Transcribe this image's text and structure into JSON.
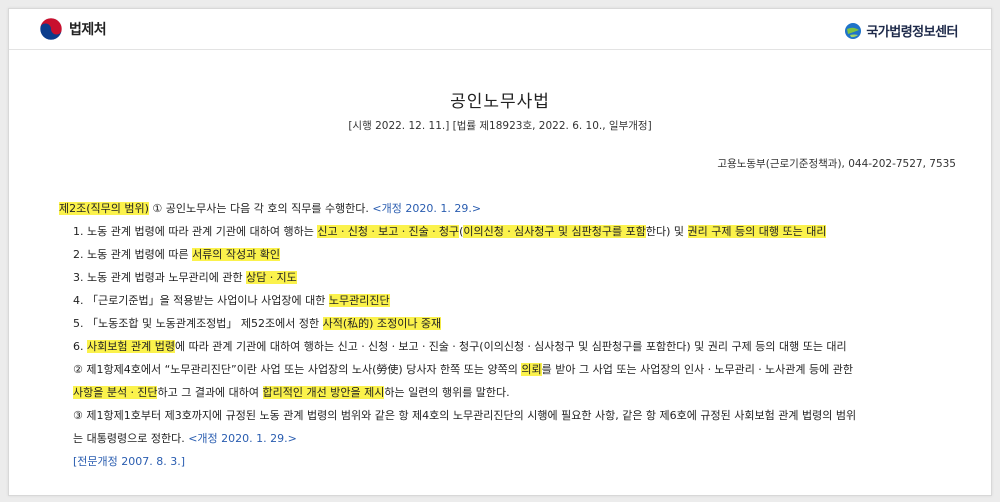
{
  "header": {
    "left_logo_text": "법제처",
    "right_logo_text": "국가법령정보센터"
  },
  "law": {
    "title": "공인노무사법",
    "enforcement": "[시행 2022. 12. 11.] [법률 제18923호, 2022. 6. 10., 일부개정]",
    "department": "고용노동부(근로기준정책과), 044-202-7527, 7535"
  },
  "article": {
    "heading_hl": "제2조(직무의 범위)",
    "heading_text": " ① 공인노무사는 다음 각 호의 직무를 수행한다. ",
    "heading_amend": "<개정 2020. 1. 29.>",
    "items": {
      "i1": {
        "a": "1. 노동 관계 법령에 따라 관계 기관에 대하여 행하는 ",
        "b": "신고ㆍ신청ㆍ보고ㆍ진술ㆍ청구",
        "c": "(",
        "d": "이의신청ㆍ심사청구 및 심판청구를 포함",
        "e": "한다) 및 ",
        "f": "권리 구제 등의 대행 또는 대리"
      },
      "i2": {
        "a": "2. 노동 관계 법령에 따른 ",
        "b": "서류의 작성과 확인"
      },
      "i3": {
        "a": "3. 노동 관계 법령과 노무관리에 관한 ",
        "b": "상담ㆍ지도"
      },
      "i4": {
        "a": "4. 「근로기준법」을 적용받는 사업이나 사업장에 대한 ",
        "b": "노무관리진단"
      },
      "i5": {
        "a": "5. 「노동조합 및 노동관계조정법」 제52조에서 정한 ",
        "b": "사적(私的) 조정이나 중재"
      },
      "i6": {
        "a": "6. ",
        "b": "사회보험 관계 법령",
        "c": "에 따라 관계 기관에 대하여 행하는 신고ㆍ신청ㆍ보고ㆍ진술ㆍ청구(이의신청ㆍ심사청구 및 심판청구를 포함한다) 및 권리 구제 등의 대행 또는 대리"
      }
    },
    "para2": {
      "line1a": "② 제1항제4호에서 “노무관리진단”이란 사업 또는 사업장의 노사(勞使) 당사자 한쪽 또는 양쪽의 ",
      "line1b": "의뢰",
      "line1c": "를 받아 그 사업 또는 사업장의 인사ㆍ노무관리ㆍ노사관계 등에 관한",
      "line2a": "사항을 분석ㆍ진단",
      "line2b": "하고 그 결과에 대하여 ",
      "line2c": "합리적인 개선 방안을 제시",
      "line2d": "하는 일련의 행위를 말한다."
    },
    "para3": {
      "line1": "③ 제1항제1호부터 제3호까지에 규정된 노동 관계 법령의 범위와 같은 항 제4호의 노무관리진단의 시행에 필요한 사항, 같은 항 제6호에 규정된 사회보험 관계 법령의 범위",
      "line2a": "는 대통령령으로 정한다. ",
      "line2b": "<개정 2020. 1. 29.>"
    },
    "footer_note": "[전문개정 2007. 8. 3.]"
  },
  "colors": {
    "highlight": "#fbf24c",
    "amendment_blue": "#2a5db0",
    "emblem_red": "#c8102e",
    "emblem_blue": "#0b3c8c"
  }
}
